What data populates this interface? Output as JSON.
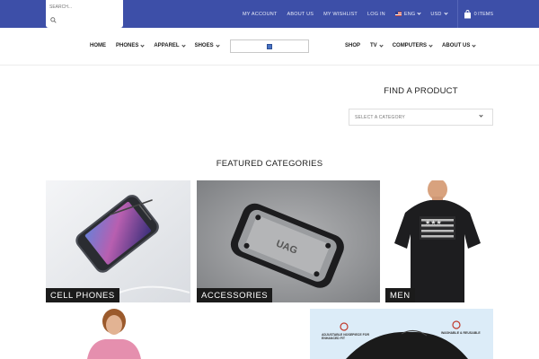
{
  "search": {
    "placeholder": "SEARCH..."
  },
  "top_links": {
    "account": "MY ACCOUNT",
    "about": "ABOUT US",
    "wishlist": "MY WISHLIST",
    "login": "LOG IN",
    "language": "ENG",
    "currency": "USD",
    "cart": "0 ITEMS"
  },
  "nav": {
    "left": [
      "HOME",
      "PHONES",
      "APPAREL",
      "SHOES"
    ],
    "right": [
      "SHOP",
      "TV",
      "COMPUTERS",
      "ABOUT US"
    ]
  },
  "find_product": {
    "title": "FIND A PRODUCT",
    "select_value": "SELECT A CATEGORY"
  },
  "featured": {
    "title": "FEATURED CATEGORIES",
    "tiles": [
      "CELL PHONES",
      "ACCESSORIES",
      "MEN"
    ]
  },
  "mask_text": {
    "left": "ADJUSTABLE NOSEPIECE FOR ENHANCED FIT",
    "right": "WASHABLE & REUSABLE"
  },
  "colors": {
    "topbar": "#3d4fa8",
    "label_bg": "#1b1b1b"
  }
}
